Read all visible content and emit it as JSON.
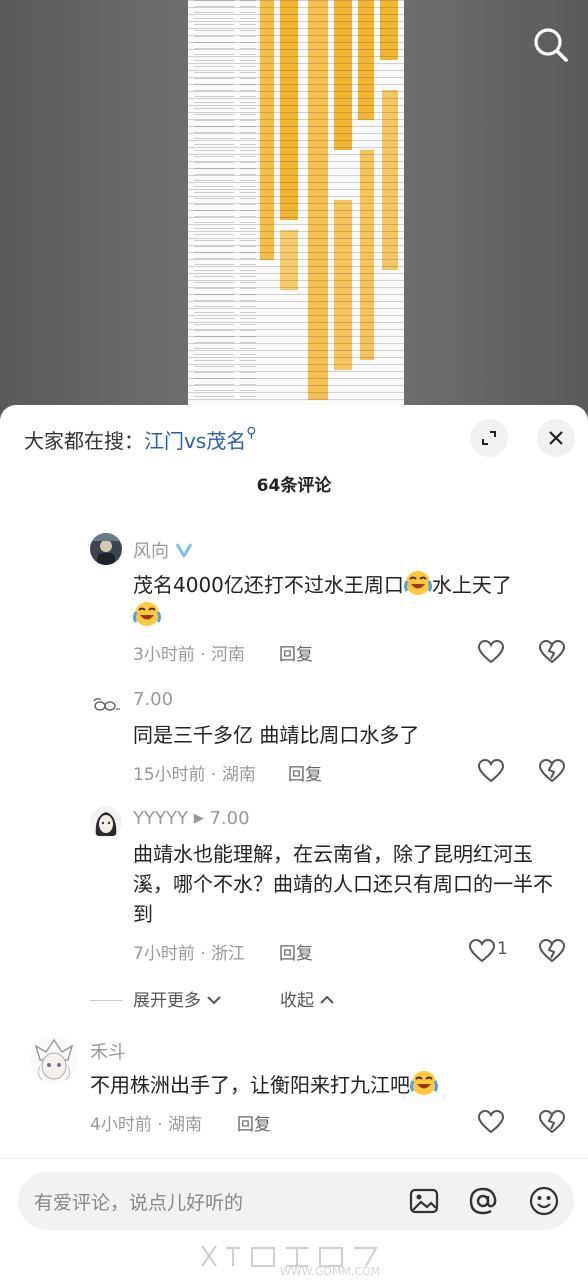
{
  "search_icon": "search-icon",
  "header": {
    "trend_prefix": "大家都在搜：",
    "trend_keyword": "江门vs茂名",
    "comment_count": "64条评论"
  },
  "comments": [
    {
      "name": "风向",
      "text_a": "茂名4000亿还打不过水王周口",
      "text_b": "水上天了",
      "time": "3小时前 · 河南",
      "reply": "回复",
      "likes": ""
    },
    {
      "name": "7.00",
      "text": "同是三千多亿 曲靖比周口水多了",
      "time": "15小时前 · 湖南",
      "reply": "回复",
      "likes": ""
    },
    {
      "name": "YYYYY",
      "reply_to": "7.00",
      "text": "曲靖水也能理解，在云南省，除了昆明红河玉溪，哪个不水？曲靖的人口还只有周口的一半不到",
      "time": "7小时前 · 浙江",
      "reply": "回复",
      "likes": "1"
    },
    {
      "name": "禾斗",
      "text": "不用株洲出手了，让衡阳来打九江吧",
      "time": "4小时前 · 湖南",
      "reply": "回复",
      "likes": ""
    }
  ],
  "thread": {
    "expand_more": "展开更多",
    "collapse": "收起"
  },
  "input": {
    "placeholder": "有爱评论，说点儿好听的"
  },
  "watermark": {
    "url": "WWW.GDMM.COM"
  },
  "colors": {
    "keyword": "#2a5db0",
    "sheet_highlight": "#f2b632",
    "verified": "#7fc3e6"
  }
}
